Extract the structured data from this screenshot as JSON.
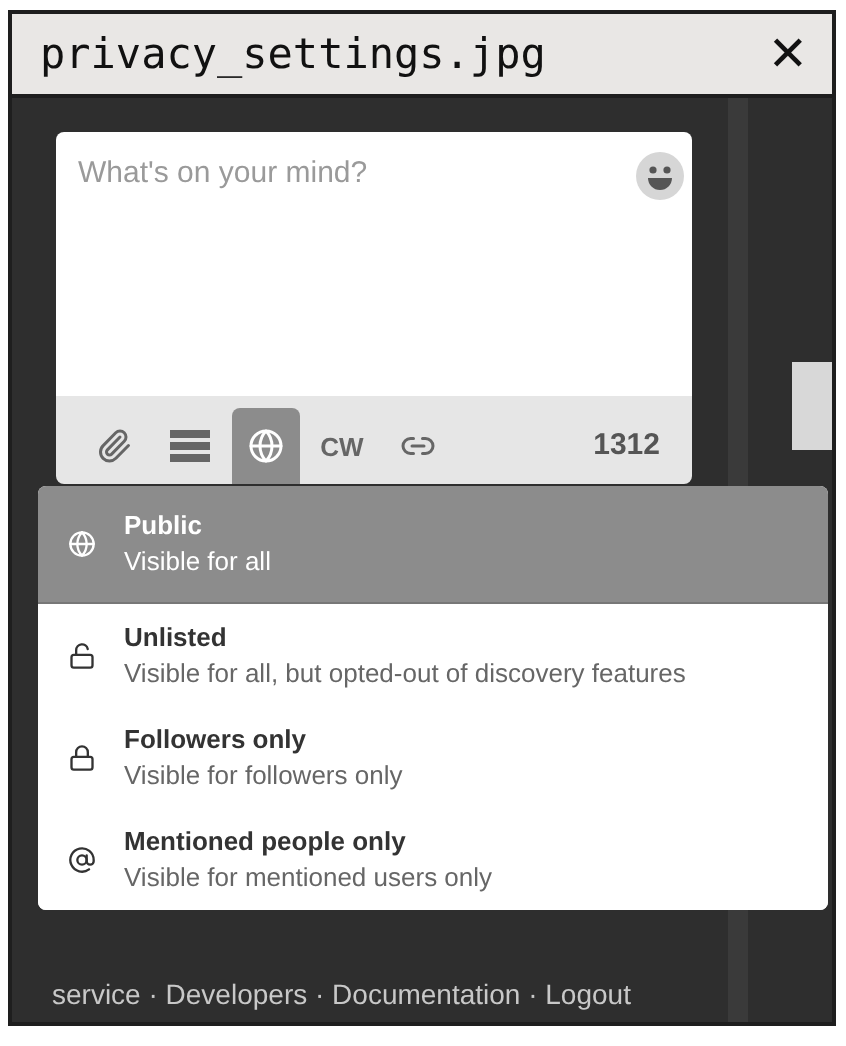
{
  "window": {
    "title": "privacy_settings.jpg",
    "close": "✕"
  },
  "compose": {
    "placeholder": "What's on your mind?",
    "char_count": "1312",
    "toolbar": [
      {
        "kind": "attach",
        "selected": false
      },
      {
        "kind": "poll",
        "selected": false
      },
      {
        "kind": "privacy",
        "selected": true
      },
      {
        "kind": "cw",
        "label": "CW",
        "selected": false
      },
      {
        "kind": "link",
        "selected": false
      }
    ]
  },
  "privacy_menu": [
    {
      "kind": "public",
      "title": "Public",
      "description": "Visible for all",
      "selected": true
    },
    {
      "kind": "unlisted",
      "title": "Unlisted",
      "description": "Visible for all, but opted-out of discovery features",
      "selected": false
    },
    {
      "kind": "private",
      "title": "Followers only",
      "description": "Visible for followers only",
      "selected": false
    },
    {
      "kind": "direct",
      "title": "Mentioned people only",
      "description": "Visible for mentioned users only",
      "selected": false
    }
  ],
  "footer": "service · Developers · Documentation · Logout"
}
